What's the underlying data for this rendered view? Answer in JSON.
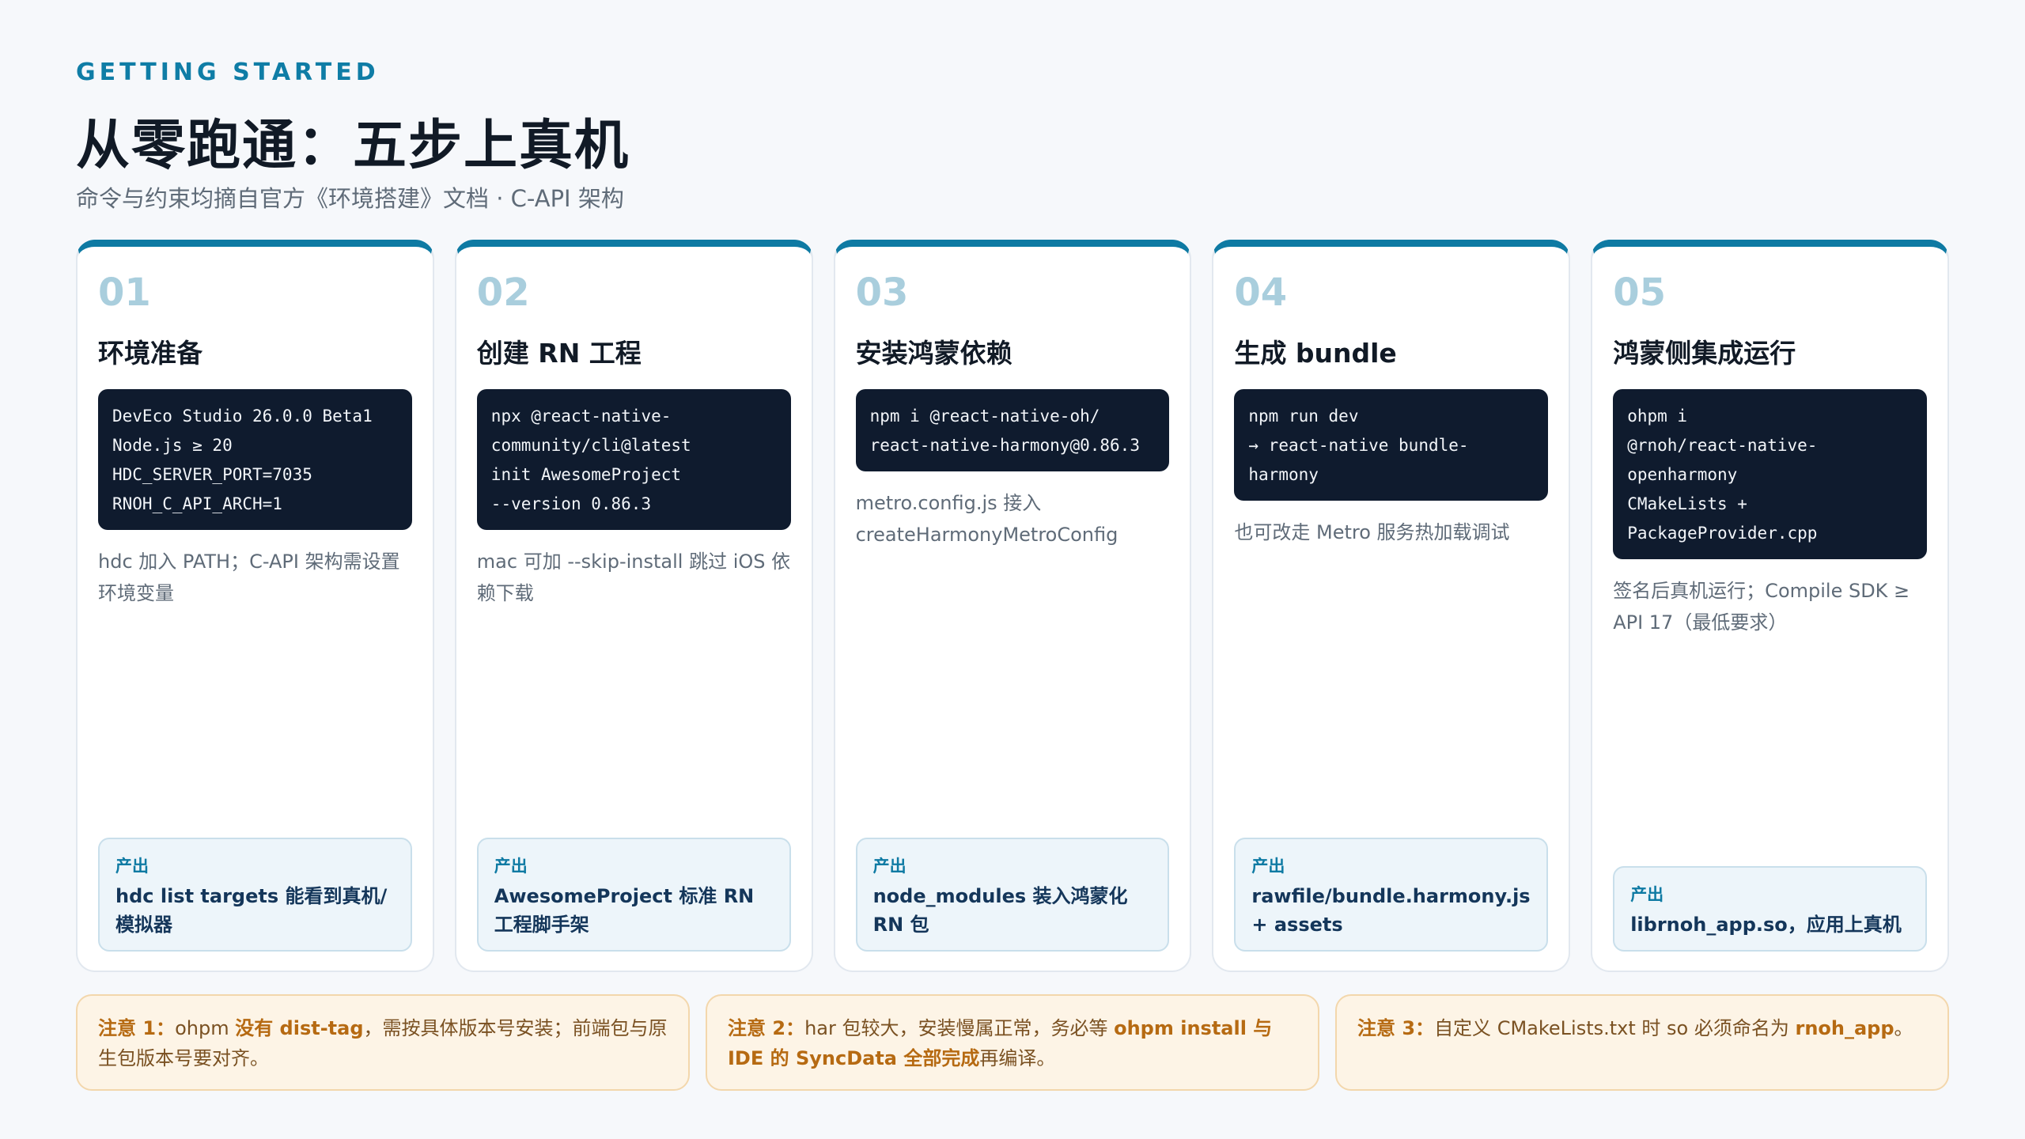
{
  "header": {
    "eyebrow": "GETTING STARTED",
    "title": "从零跑通：五步上真机",
    "subtitle": "命令与约束均摘自官方《环境搭建》文档 · C-API 架构"
  },
  "output_label": "产出",
  "steps": [
    {
      "num": "01",
      "title": "环境准备",
      "code": [
        "DevEco Studio 26.0.0 Beta1",
        "Node.js ≥ 20",
        "HDC_SERVER_PORT=7035",
        "RNOH_C_API_ARCH=1"
      ],
      "note": "hdc 加入 PATH；C-API 架构需设置环境变量",
      "output": "hdc list targets 能看到真机/模拟器"
    },
    {
      "num": "02",
      "title": "创建 RN 工程",
      "code": [
        "npx @react-native-",
        "community/cli@latest",
        "init AwesomeProject",
        "--version 0.86.3"
      ],
      "note": "mac 可加 --skip-install 跳过 iOS 依赖下载",
      "output": "AwesomeProject 标准 RN 工程脚手架"
    },
    {
      "num": "03",
      "title": "安装鸿蒙依赖",
      "code": [
        "npm i @react-native-oh/",
        "react-native-harmony@0.86.3"
      ],
      "note": "metro.config.js 接入 createHarmonyMetroConfig",
      "output": "node_modules 装入鸿蒙化 RN 包"
    },
    {
      "num": "04",
      "title": "生成 bundle",
      "code": [
        "npm run dev",
        "→ react-native bundle-",
        "harmony"
      ],
      "note": "也可改走 Metro 服务热加载调试",
      "output": "rawfile/bundle.harmony.js + assets"
    },
    {
      "num": "05",
      "title": "鸿蒙侧集成运行",
      "code": [
        "ohpm i",
        "@rnoh/react-native-",
        "openharmony",
        "CMakeLists +",
        "PackageProvider.cpp"
      ],
      "note": "签名后真机运行；Compile SDK ≥ API 17（最低要求）",
      "output": "librnoh_app.so，应用上真机"
    }
  ],
  "warnings": [
    {
      "label": "注意 1：",
      "t1": "ohpm ",
      "b1": "没有 dist-tag",
      "t2": "，需按具体版本号安装；前端包与原生包版本号要对齐。",
      "b2": "",
      "t3": ""
    },
    {
      "label": "注意 2：",
      "t1": "har 包较大，安装慢属正常，务必等 ",
      "b1": "ohpm install 与 IDE 的 SyncData 全部完成",
      "t2": "再编译。",
      "b2": "",
      "t3": ""
    },
    {
      "label": "注意 3：",
      "t1": "自定义 CMakeLists.txt 时 so 必须命名为 ",
      "b1": "rnoh_app",
      "t2": "。",
      "b2": "",
      "t3": ""
    }
  ],
  "colors": {
    "accent": "#0e7aa3",
    "code_bg": "#0f1b2e",
    "warn_bg": "#fdf4e6",
    "warn_accent": "#b66a12"
  }
}
